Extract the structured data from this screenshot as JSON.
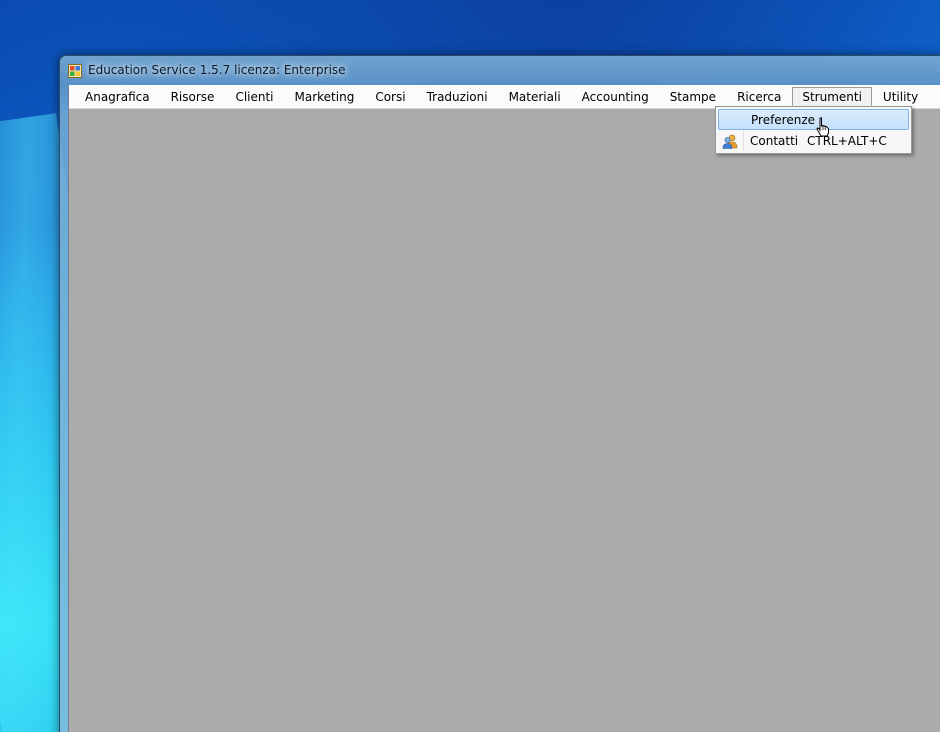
{
  "window": {
    "title": "Education Service 1.5.7 licenza: Enterprise",
    "icon": "app-window-icon"
  },
  "menubar": {
    "items": [
      {
        "label": "Anagrafica"
      },
      {
        "label": "Risorse"
      },
      {
        "label": "Clienti"
      },
      {
        "label": "Marketing"
      },
      {
        "label": "Corsi"
      },
      {
        "label": "Traduzioni"
      },
      {
        "label": "Materiali"
      },
      {
        "label": "Accounting"
      },
      {
        "label": "Stampe"
      },
      {
        "label": "Ricerca"
      },
      {
        "label": "Strumenti",
        "open": true
      },
      {
        "label": "Utility"
      },
      {
        "label": "?"
      }
    ]
  },
  "dropdown": {
    "items": [
      {
        "label": "Preferenze",
        "shortcut": "",
        "icon": "",
        "highlighted": true
      },
      {
        "label": "Contatti",
        "shortcut": "CTRL+ALT+C",
        "icon": "contacts-icon"
      }
    ]
  },
  "colors": {
    "client_background": "#ababab",
    "menubar_background": "#fbfbfb",
    "highlight": "#c4e0fb",
    "highlight_border": "#7eb4ea"
  }
}
